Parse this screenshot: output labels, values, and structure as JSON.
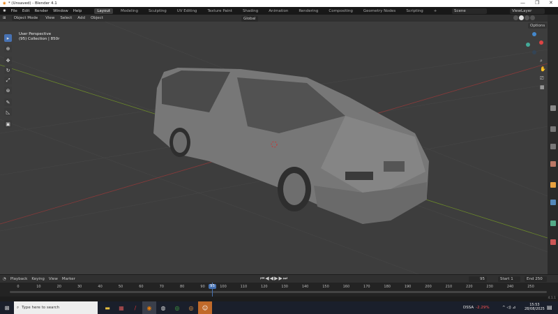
{
  "window": {
    "title": "* (Unsaved) - Blender 4.1",
    "minimize": "—",
    "maximize": "❐",
    "close": "✕"
  },
  "menu": [
    "File",
    "Edit",
    "Render",
    "Window",
    "Help"
  ],
  "workspaces": [
    "Layout",
    "Modeling",
    "Sculpting",
    "UV Editing",
    "Texture Paint",
    "Shading",
    "Animation",
    "Rendering",
    "Compositing",
    "Geometry Nodes",
    "Scripting",
    "+"
  ],
  "scene": "Scene",
  "view_layer": "ViewLayer",
  "header": {
    "mode": "Object Mode",
    "items": [
      "View",
      "Select",
      "Add",
      "Object"
    ],
    "orientation": "Global",
    "options": "Options"
  },
  "viewport": {
    "perspective": "User Perspective",
    "collection": "(95) Collection | 850r",
    "axes": {
      "x": "X",
      "y": "Y",
      "z": "Z"
    }
  },
  "timeline": {
    "menus": [
      "Playback",
      "Keying",
      "View",
      "Marker"
    ],
    "current_frame": "95",
    "start_label": "Start",
    "start": "1",
    "end_label": "End",
    "end": "250",
    "ticks": [
      "0",
      "10",
      "20",
      "30",
      "40",
      "50",
      "60",
      "70",
      "80",
      "90",
      "100",
      "110",
      "120",
      "130",
      "140",
      "150",
      "160",
      "170",
      "180",
      "190",
      "200",
      "210",
      "220",
      "230",
      "240",
      "250"
    ],
    "version": "4.1.1"
  },
  "taskbar": {
    "search_placeholder": "Type here to search",
    "stock": "DSSA",
    "stock_change": "-2.29%",
    "time": "15:53",
    "date": "28/08/2025"
  },
  "colors": {
    "accent": "#4772b3",
    "viewport": "#3d3d3d",
    "frame": "#4772b3"
  }
}
